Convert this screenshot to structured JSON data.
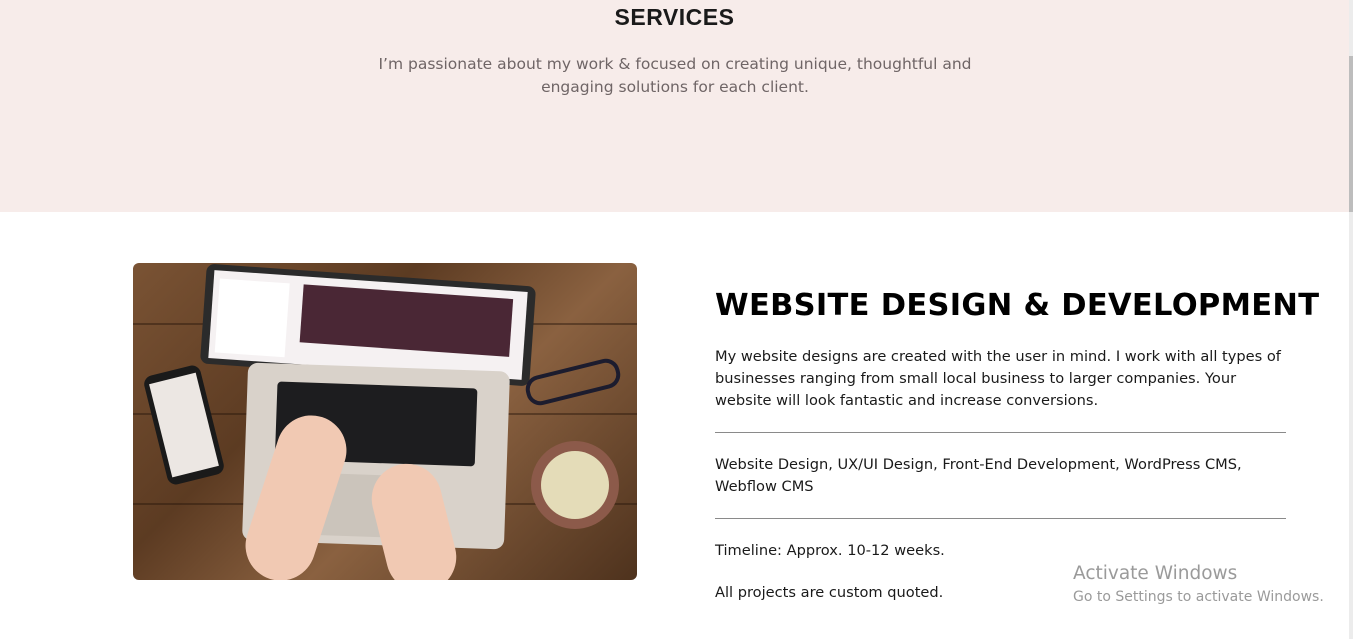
{
  "hero": {
    "title": "SERVICES",
    "subtitle": "I’m passionate about my work & focused on creating unique, thoughtful and engaging solutions for each client."
  },
  "service": {
    "image_alt": "Hands typing on a laptop on a wooden desk with a phone, glasses and a coffee mug",
    "title": "WEBSITE DESIGN & DEVELOPMENT",
    "description": "My website designs are created with the user in mind. I work with all types of businesses ranging from small local business to larger companies. Your website will look fantastic and increase conversions.",
    "services_list": "Website Design, UX/UI Design, Front-End Development, WordPress CMS, Webflow CMS",
    "timeline": "Timeline: Approx. 10-12 weeks.",
    "quote_note": "All projects are custom quoted."
  },
  "watermark": {
    "title": "Activate Windows",
    "subtitle": "Go to Settings to activate Windows."
  },
  "colors": {
    "hero_bg": "#f7ecea",
    "subtitle_text": "#6f6566",
    "divider": "#8a8a8a"
  }
}
